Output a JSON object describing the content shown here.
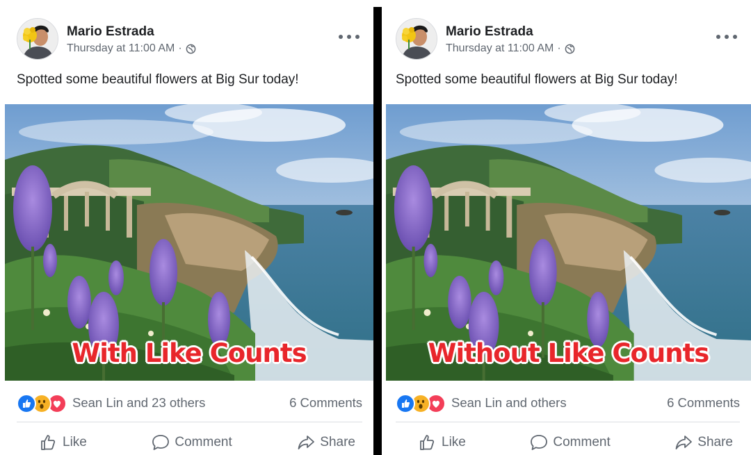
{
  "posts": [
    {
      "author": "Mario Estrada",
      "timestamp": "Thursday at 11:00 AM",
      "separator": "·",
      "privacy_icon": "globe-icon",
      "caption": "Spotted some beautiful flowers at Big Sur today!",
      "overlay": "With Like Counts",
      "reactions": [
        "like",
        "wow",
        "love"
      ],
      "reaction_names": "Sean Lin and 23 others",
      "comments": "6 Comments",
      "actions": {
        "like": "Like",
        "comment": "Comment",
        "share": "Share"
      }
    },
    {
      "author": "Mario Estrada",
      "timestamp": "Thursday at 11:00 AM",
      "separator": "·",
      "privacy_icon": "globe-icon",
      "caption": "Spotted some beautiful flowers at Big Sur today!",
      "overlay": "Without Like Counts",
      "reactions": [
        "like",
        "wow",
        "love"
      ],
      "reaction_names": "Sean Lin and others",
      "comments": "6 Comments",
      "actions": {
        "like": "Like",
        "comment": "Comment",
        "share": "Share"
      }
    }
  ],
  "colors": {
    "facebook_blue": "#1877f2",
    "wow_yellow": "#f7b125",
    "love_red": "#f33e58",
    "overlay_red": "#e8262b",
    "meta_gray": "#606770",
    "text_dark": "#1c1e21"
  }
}
